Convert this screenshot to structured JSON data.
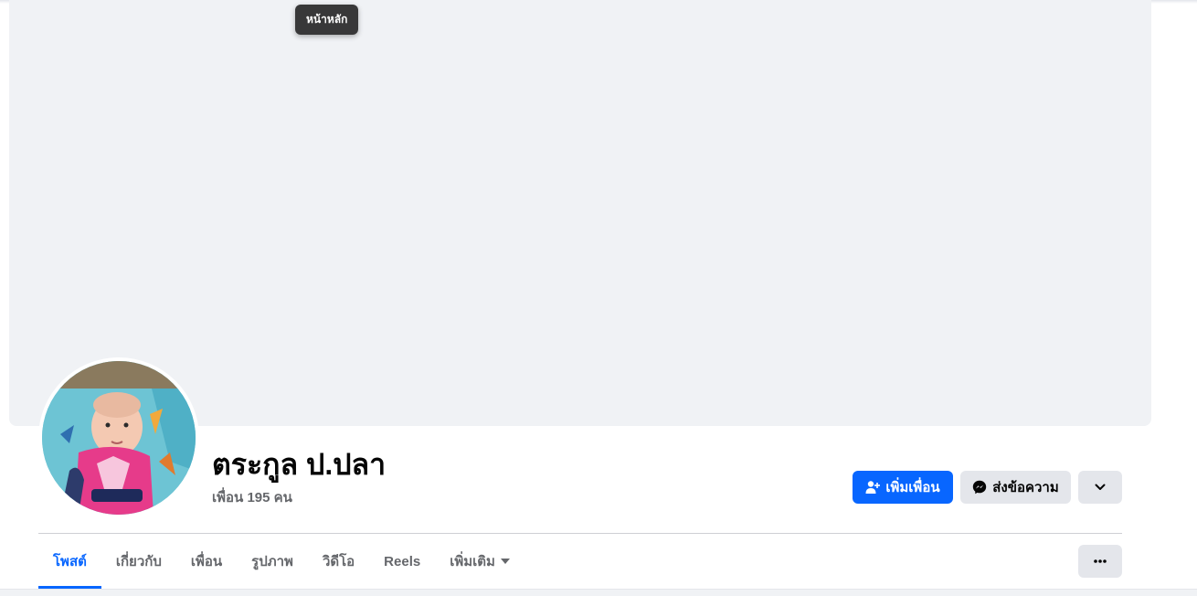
{
  "tooltip": {
    "text": "หน้าหลัก"
  },
  "profile": {
    "name": "ตระกูล ป.ปลา",
    "friends_text": "เพื่อน 195 คน"
  },
  "actions": {
    "add_friend_label": "เพิ่มเพื่อน",
    "add_friend_icon": "add-friend-icon",
    "message_label": "ส่งข้อความ",
    "message_icon": "messenger-icon",
    "dropdown_icon": "chevron-down-icon"
  },
  "tabs": [
    {
      "label": "โพสต์",
      "active": true
    },
    {
      "label": "เกี่ยวกับ",
      "active": false
    },
    {
      "label": "เพื่อน",
      "active": false
    },
    {
      "label": "รูปภาพ",
      "active": false
    },
    {
      "label": "วิดีโอ",
      "active": false
    },
    {
      "label": "Reels",
      "active": false
    },
    {
      "label": "เพิ่มเติม",
      "active": false,
      "has_caret": true
    }
  ],
  "more_button": {
    "icon": "more-dots-icon"
  },
  "colors": {
    "accent": "#0866ff",
    "cover": "#f0f2f5",
    "secondary_button": "#e4e6eb",
    "secondary_text": "#65676b"
  }
}
